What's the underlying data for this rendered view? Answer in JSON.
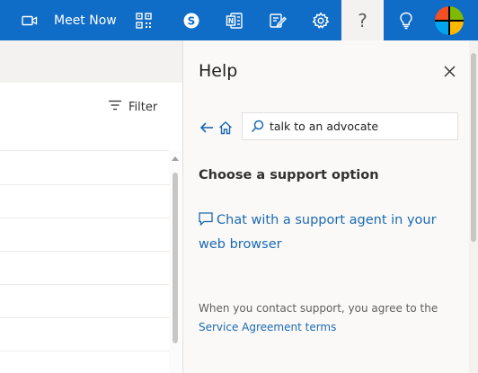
{
  "topbar": {
    "meet_now_label": "Meet Now",
    "help_glyph": "?",
    "icons": [
      "video-icon",
      "qr-code-icon",
      "skype-icon",
      "onenote-icon",
      "tasks-icon",
      "gear-icon",
      "question-icon",
      "lightbulb-icon",
      "avatar"
    ],
    "colors": {
      "bar": "#0f6cc7",
      "help_active_bg": "#f3f2f1"
    }
  },
  "list": {
    "filter_label": "Filter"
  },
  "help_panel": {
    "title": "Help",
    "search": {
      "value": "talk to an advocate"
    },
    "support_heading": "Choose a support option",
    "chat_link": "Chat with a support agent in your web browser",
    "disclaimer_prefix": "When you contact support, you agree to the",
    "terms_link": "Service Agreement terms",
    "colors": {
      "link": "#1b6ab2",
      "panel_bg": "#faf9f8"
    }
  }
}
